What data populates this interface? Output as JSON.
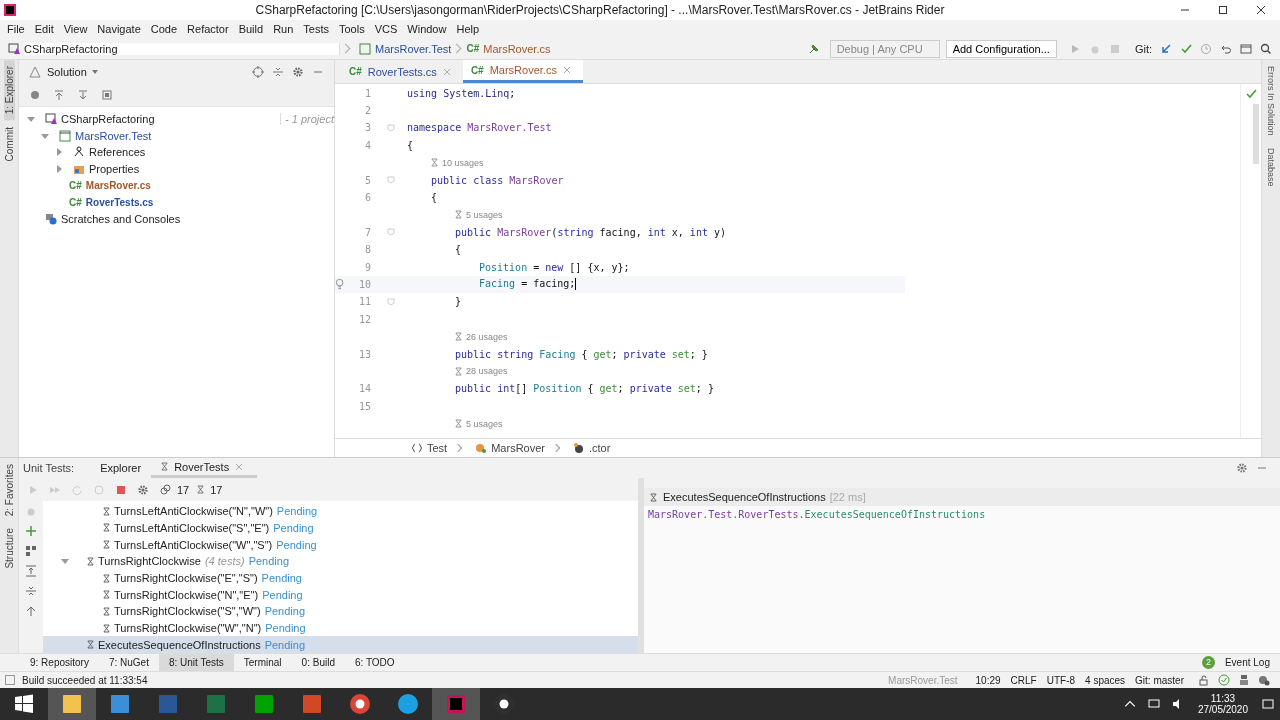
{
  "window": {
    "title": "CSharpRefactoring [C:\\Users\\jasongorman\\RiderProjects\\CSharpRefactoring] - ...\\MarsRover.Test\\MarsRover.cs - JetBrains Rider"
  },
  "menu": [
    "File",
    "Edit",
    "View",
    "Navigate",
    "Code",
    "Refactor",
    "Build",
    "Run",
    "Tests",
    "Tools",
    "VCS",
    "Window",
    "Help"
  ],
  "breadcrumbs": [
    {
      "label": "CSharpRefactoring",
      "kind": "solution"
    },
    {
      "label": "MarsRover.Test",
      "kind": "project"
    },
    {
      "label": "MarsRover.cs",
      "kind": "file",
      "badge": "C#"
    }
  ],
  "toolbar": {
    "config": "Debug | Any CPU",
    "add_config": "Add Configuration...",
    "git": "Git:"
  },
  "left_stripe": [
    {
      "label": "1: Explorer",
      "selected": true
    },
    {
      "label": "Commit",
      "selected": false
    }
  ],
  "solution": {
    "title": "Solution",
    "tree": [
      {
        "label": "CSharpRefactoring",
        "note": "- 1 project",
        "kind": "solution",
        "expanded": true,
        "children": [
          {
            "label": "MarsRover.Test",
            "kind": "project",
            "expanded": true,
            "children": [
              {
                "label": "References",
                "kind": "refs",
                "expanded": false
              },
              {
                "label": "Properties",
                "kind": "props",
                "expanded": false
              },
              {
                "label": "MarsRover.cs",
                "kind": "cs",
                "badge": "C#",
                "modified": true
              },
              {
                "label": "RoverTests.cs",
                "kind": "cs",
                "badge": "C#",
                "modified": false
              }
            ]
          }
        ]
      },
      {
        "label": "Scratches and Consoles",
        "kind": "scratch"
      }
    ]
  },
  "editor": {
    "tabs": [
      {
        "label": "RoverTests.cs",
        "badge": "C#",
        "selected": false,
        "modified": false
      },
      {
        "label": "MarsRover.cs",
        "badge": "C#",
        "selected": true,
        "modified": true
      }
    ],
    "lines": [
      {
        "num": "1",
        "tokens": [
          {
            "t": "using ",
            "kind": "kw"
          },
          {
            "t": "System.Linq",
            "kind": "ns"
          },
          {
            "t": ";",
            "kind": "plain"
          }
        ]
      },
      {
        "num": "2"
      },
      {
        "num": "3",
        "fold": true,
        "tokens": [
          {
            "t": "namespace ",
            "kind": "kw"
          },
          {
            "t": "MarsRover.Test",
            "kind": "type"
          }
        ]
      },
      {
        "num": "4",
        "tokens": [
          {
            "t": "{",
            "kind": "plain"
          }
        ],
        "children": [
          {
            "num": "5",
            "hint": "10 usages",
            "fold": true,
            "tokens": [
              {
                "t": "public class ",
                "kind": "kw"
              },
              {
                "t": "MarsRover",
                "kind": "type"
              }
            ]
          },
          {
            "num": "6",
            "tokens": [
              {
                "t": "{",
                "kind": "plain"
              }
            ],
            "children": [
              {
                "num": "7",
                "hint": "5 usages",
                "fold": true,
                "tokens": [
                  {
                    "t": "public ",
                    "kind": "kw"
                  },
                  {
                    "t": "MarsRover",
                    "kind": "type"
                  },
                  {
                    "t": "(",
                    "kind": "plain"
                  },
                  {
                    "t": "string ",
                    "kind": "kw"
                  },
                  {
                    "t": "facing, ",
                    "kind": "plain"
                  },
                  {
                    "t": "int ",
                    "kind": "kw"
                  },
                  {
                    "t": "x, ",
                    "kind": "plain"
                  },
                  {
                    "t": "int ",
                    "kind": "kw"
                  },
                  {
                    "t": "y)",
                    "kind": "plain"
                  }
                ]
              },
              {
                "num": "8",
                "tokens": [
                  {
                    "t": "{",
                    "kind": "plain"
                  }
                ],
                "children": [
                  {
                    "num": "9",
                    "tokens": [
                      {
                        "t": "Position",
                        "kind": "prop"
                      },
                      {
                        "t": " = ",
                        "kind": "plain"
                      },
                      {
                        "t": "new",
                        "kind": "kw"
                      },
                      {
                        "t": " [] {x, y};",
                        "kind": "plain"
                      }
                    ]
                  },
                  {
                    "num": "10",
                    "current": true,
                    "bulb": true,
                    "tokens": [
                      {
                        "t": "Facing",
                        "kind": "prop"
                      },
                      {
                        "t": " = facing;",
                        "kind": "plain"
                      }
                    ]
                  }
                ]
              },
              {
                "num": "11",
                "fold": true,
                "tokens": [
                  {
                    "t": "}",
                    "kind": "plain"
                  }
                ]
              },
              {
                "num": "12"
              },
              {
                "num": "13",
                "hint": "26 usages",
                "tokens": [
                  {
                    "t": "public string ",
                    "kind": "kw"
                  },
                  {
                    "t": "Facing",
                    "kind": "prop"
                  },
                  {
                    "t": " { ",
                    "kind": "plain"
                  },
                  {
                    "t": "get",
                    "kind": "acc"
                  },
                  {
                    "t": "; ",
                    "kind": "plain"
                  },
                  {
                    "t": "private ",
                    "kind": "kw"
                  },
                  {
                    "t": "set",
                    "kind": "acc"
                  },
                  {
                    "t": "; }",
                    "kind": "plain"
                  }
                ]
              },
              {
                "num": "14",
                "hint": "28 usages",
                "tokens": [
                  {
                    "t": "public int",
                    "kind": "kw"
                  },
                  {
                    "t": "[] ",
                    "kind": "plain"
                  },
                  {
                    "t": "Position",
                    "kind": "prop"
                  },
                  {
                    "t": " { ",
                    "kind": "plain"
                  },
                  {
                    "t": "get",
                    "kind": "acc"
                  },
                  {
                    "t": "; ",
                    "kind": "plain"
                  },
                  {
                    "t": "private ",
                    "kind": "kw"
                  },
                  {
                    "t": "set",
                    "kind": "acc"
                  },
                  {
                    "t": "; }",
                    "kind": "plain"
                  }
                ]
              },
              {
                "num": "15"
              },
              {
                "hint": "5 usages"
              }
            ]
          }
        ]
      }
    ],
    "path": [
      "Test",
      "MarsRover",
      ".ctor"
    ]
  },
  "right_stripe": [
    "Errors In Solution",
    "Database"
  ],
  "unit_tests": {
    "label": "Unit Tests:",
    "tabs": [
      {
        "label": "Explorer",
        "selected": false
      },
      {
        "label": "RoverTests",
        "selected": true
      }
    ],
    "counts": [
      "17",
      "17"
    ],
    "side": [
      "2: Favorites",
      "Structure"
    ],
    "tests": [
      {
        "children": [
          {
            "name": "TurnsLeftAntiClockwise(\"N\",\"W\")",
            "status": "Pending",
            "selected": false
          },
          {
            "name": "TurnsLeftAntiClockwise(\"S\",\"E\")",
            "status": "Pending",
            "selected": false
          },
          {
            "name": "TurnsLeftAntiClockwise(\"W\",\"S\")",
            "status": "Pending",
            "selected": false
          }
        ]
      },
      {
        "name": "TurnsRightClockwise",
        "note": "(4 tests)",
        "status": "Pending",
        "selected": false,
        "expanded": true,
        "children": [
          {
            "name": "TurnsRightClockwise(\"E\",\"S\")",
            "status": "Pending",
            "selected": false
          },
          {
            "name": "TurnsRightClockwise(\"N\",\"E\")",
            "status": "Pending",
            "selected": false
          },
          {
            "name": "TurnsRightClockwise(\"S\",\"W\")",
            "status": "Pending",
            "selected": false
          },
          {
            "name": "TurnsRightClockwise(\"W\",\"N\")",
            "status": "Pending",
            "selected": false
          }
        ]
      },
      {
        "name": "ExecutesSequenceOfInstructions",
        "status": "Pending",
        "selected": true
      }
    ],
    "detail": {
      "name": "ExecutesSequenceOfInstructions",
      "time": "[22 ms]",
      "output": [
        {
          "t": "MarsRover.Test.RoverTests.",
          "kind": "type"
        },
        {
          "t": "ExecutesSequenceOfInstructions",
          "kind": "method"
        }
      ]
    }
  },
  "tool_windows": [
    {
      "label": "9: Repository",
      "selected": false
    },
    {
      "label": "7: NuGet",
      "selected": false
    },
    {
      "label": "8: Unit Tests",
      "selected": true
    },
    {
      "label": "Terminal",
      "selected": false
    },
    {
      "label": "0: Build",
      "selected": false
    },
    {
      "label": "6: TODO",
      "selected": false
    }
  ],
  "event_log": {
    "count": "2",
    "label": "Event Log"
  },
  "status_bar": {
    "message": "Build succeeded at 11:33:54",
    "project": "MarsRover.Test",
    "items": [
      "10:29",
      "CRLF",
      "UTF-8",
      "4 spaces",
      "Git: master"
    ]
  },
  "taskbar": {
    "apps": [
      {
        "kind": "explorer",
        "selected": true
      },
      {
        "kind": "monitor",
        "selected": false
      },
      {
        "kind": "word",
        "selected": false
      },
      {
        "kind": "excel",
        "selected": false
      },
      {
        "kind": "store",
        "selected": false
      },
      {
        "kind": "powerpoint",
        "selected": false
      },
      {
        "kind": "chrome",
        "selected": false
      },
      {
        "kind": "ie",
        "selected": false
      },
      {
        "kind": "rider",
        "selected": true
      },
      {
        "kind": "obs",
        "selected": false
      }
    ],
    "time": "11:33",
    "date": "27/05/2020"
  }
}
